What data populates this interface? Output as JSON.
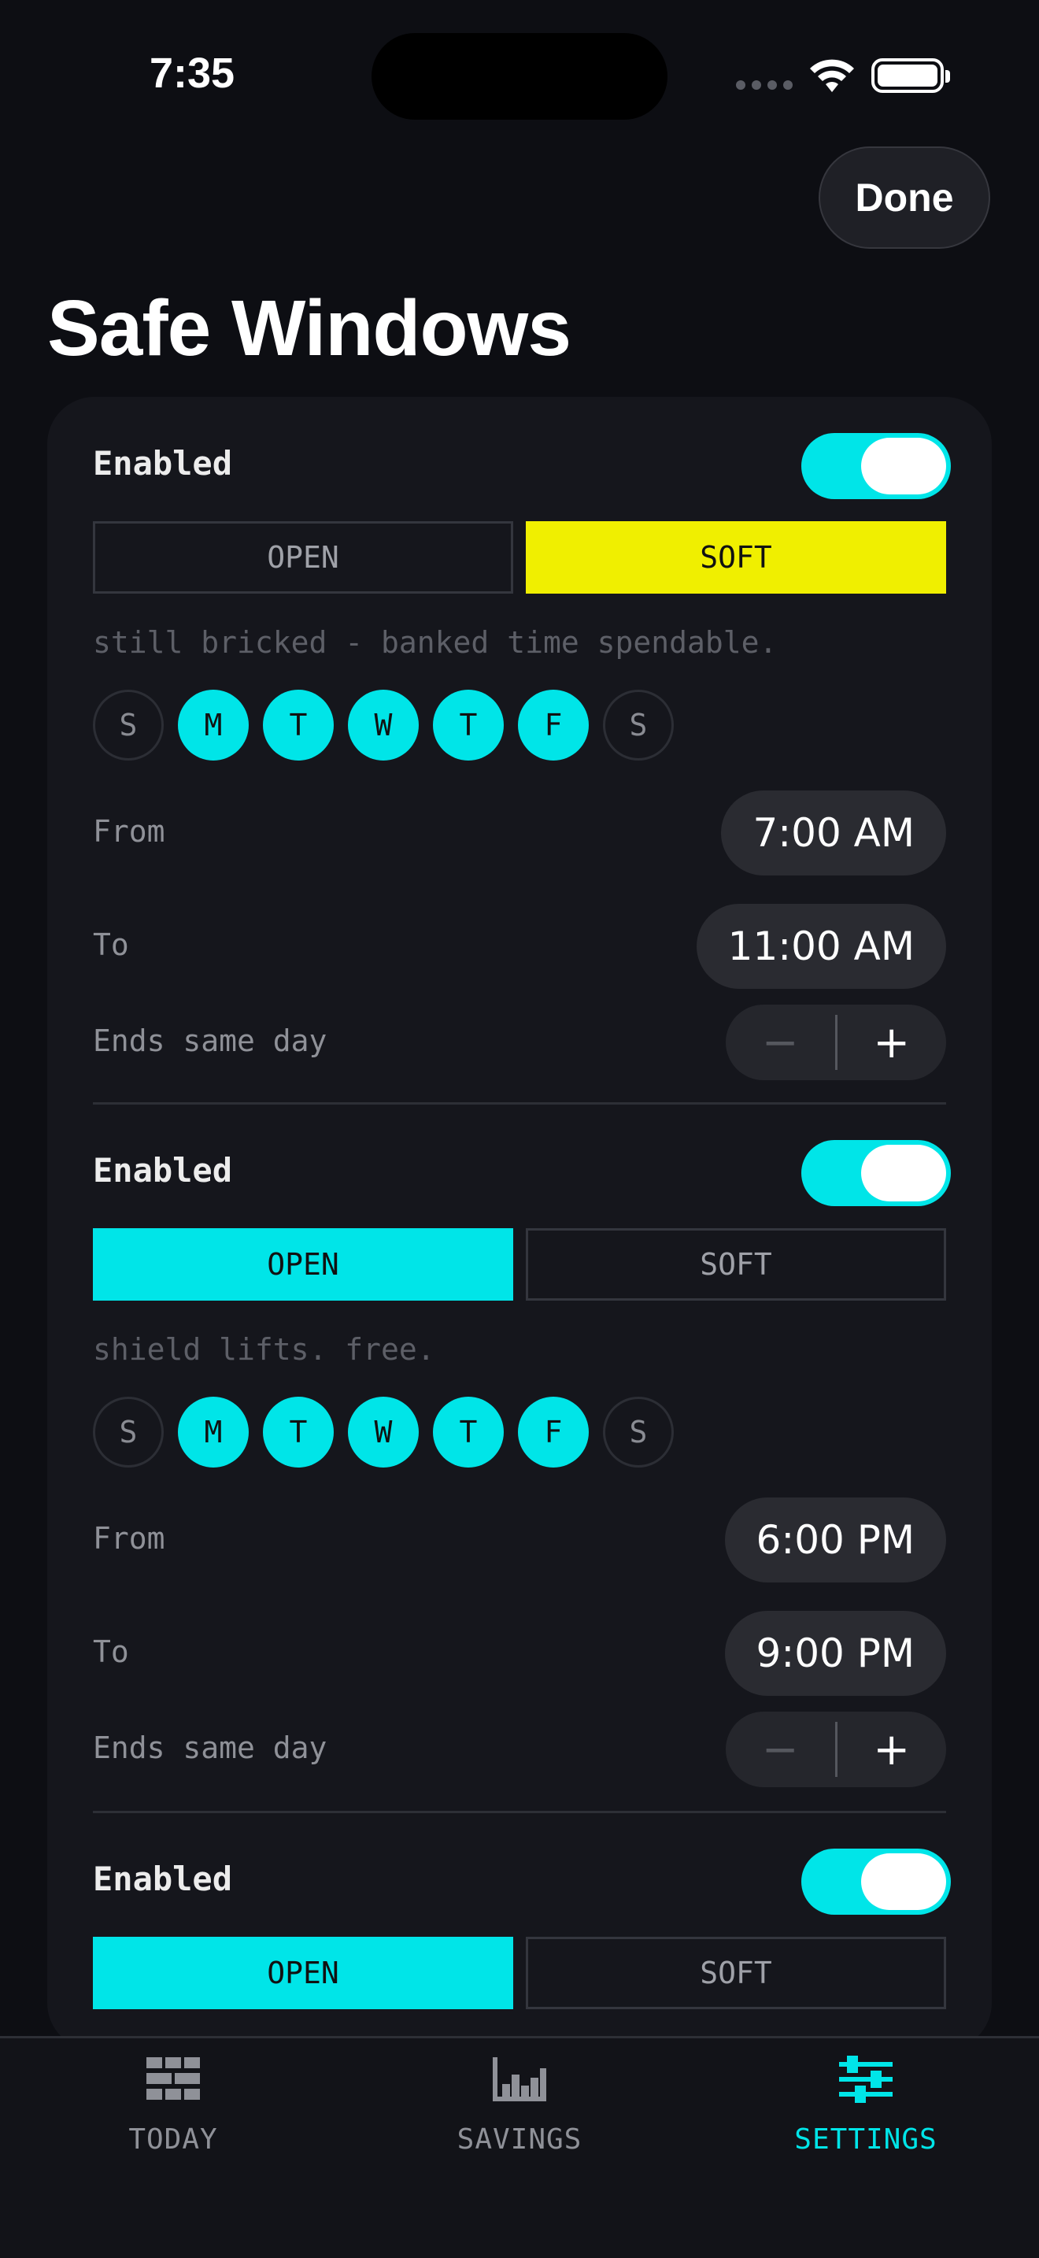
{
  "status_bar": {
    "time": "7:35"
  },
  "header": {
    "done_label": "Done",
    "title": "Safe Windows"
  },
  "windows": [
    {
      "enabled_label": "Enabled",
      "enabled": true,
      "mode_options": [
        "OPEN",
        "SOFT"
      ],
      "selected_mode": "SOFT",
      "hint": "still bricked - banked time spendable.",
      "days": [
        {
          "label": "S",
          "on": false
        },
        {
          "label": "M",
          "on": true
        },
        {
          "label": "T",
          "on": true
        },
        {
          "label": "W",
          "on": true
        },
        {
          "label": "T",
          "on": true
        },
        {
          "label": "F",
          "on": true
        },
        {
          "label": "S",
          "on": false
        }
      ],
      "from_label": "From",
      "from_value": "7:00 AM",
      "to_label": "To",
      "to_value": "11:00 AM",
      "ends_label": "Ends same day"
    },
    {
      "enabled_label": "Enabled",
      "enabled": true,
      "mode_options": [
        "OPEN",
        "SOFT"
      ],
      "selected_mode": "OPEN",
      "hint": "shield lifts. free.",
      "days": [
        {
          "label": "S",
          "on": false
        },
        {
          "label": "M",
          "on": true
        },
        {
          "label": "T",
          "on": true
        },
        {
          "label": "W",
          "on": true
        },
        {
          "label": "T",
          "on": true
        },
        {
          "label": "F",
          "on": true
        },
        {
          "label": "S",
          "on": false
        }
      ],
      "from_label": "From",
      "from_value": "6:00 PM",
      "to_label": "To",
      "to_value": "9:00 PM",
      "ends_label": "Ends same day"
    },
    {
      "enabled_label": "Enabled",
      "enabled": true,
      "mode_options": [
        "OPEN",
        "SOFT"
      ],
      "selected_mode": "OPEN"
    }
  ],
  "tabs": [
    {
      "label": "TODAY",
      "icon": "calendar-grid-icon",
      "active": false
    },
    {
      "label": "SAVINGS",
      "icon": "bar-chart-icon",
      "active": false
    },
    {
      "label": "SETTINGS",
      "icon": "sliders-icon",
      "active": true
    }
  ],
  "colors": {
    "accent_cyan": "#00e5e8",
    "accent_yellow": "#f0ef00",
    "background": "#0d0e13",
    "card": "#15161c"
  }
}
